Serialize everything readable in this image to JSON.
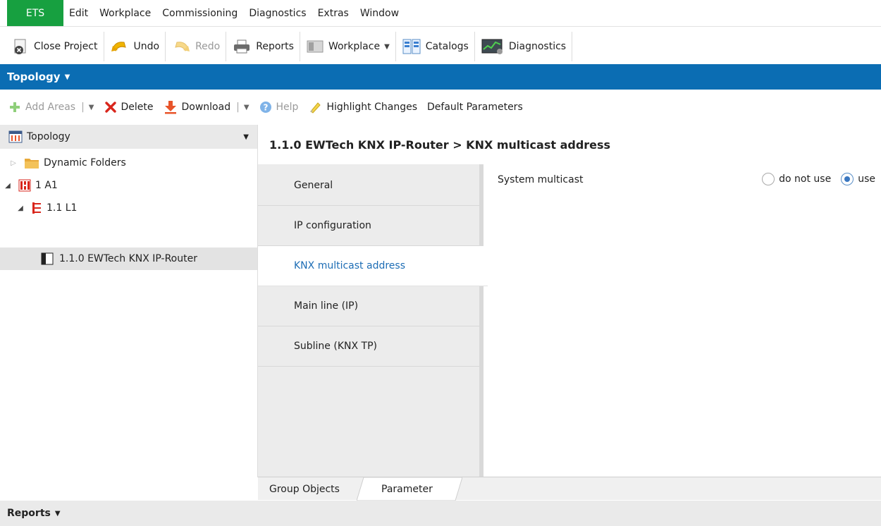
{
  "menu": {
    "app": "ETS",
    "items": [
      "Edit",
      "Workplace",
      "Commissioning",
      "Diagnostics",
      "Extras",
      "Window"
    ]
  },
  "toolbar": {
    "close_project": "Close Project",
    "undo": "Undo",
    "redo": "Redo",
    "reports": "Reports",
    "workplace": "Workplace",
    "catalogs": "Catalogs",
    "diagnostics": "Diagnostics"
  },
  "panel_bar": {
    "title": "Topology"
  },
  "actions": {
    "add_areas": "Add Areas",
    "delete": "Delete",
    "download": "Download",
    "help": "Help",
    "highlight_changes": "Highlight Changes",
    "default_parameters": "Default Parameters"
  },
  "tree": {
    "header": "Topology",
    "nodes": [
      {
        "label": "Dynamic Folders"
      },
      {
        "label": "1 A1"
      },
      {
        "label": "1.1 L1"
      },
      {
        "label": "1.1.0 EWTech KNX IP-Router"
      }
    ]
  },
  "content": {
    "breadcrumb": "1.1.0 EWTech KNX IP-Router > KNX multicast address",
    "param_tabs": [
      {
        "label": "General"
      },
      {
        "label": "IP configuration"
      },
      {
        "label": "KNX multicast address"
      },
      {
        "label": "Main line (IP)"
      },
      {
        "label": "Subline (KNX TP)"
      }
    ],
    "active_tab": "KNX multicast address",
    "parameter": {
      "label": "System multicast",
      "options": [
        "do not use",
        "use"
      ],
      "selected": "use"
    }
  },
  "bottom_tabs": [
    "Group Objects",
    "Parameter"
  ],
  "reports_bar": {
    "title": "Reports"
  },
  "colors": {
    "ets_green": "#17a040",
    "topology_blue": "#0b6db3",
    "active_tab_text": "#1d6db5",
    "delete_red": "#d9261c"
  }
}
